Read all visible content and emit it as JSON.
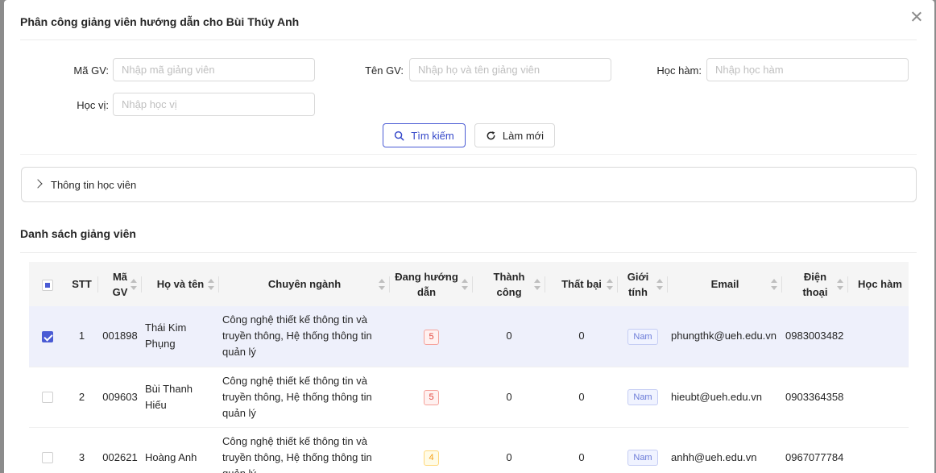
{
  "modal": {
    "title": "Phân công giảng viên hướng dẫn cho Bùi Thúy Anh"
  },
  "filters": {
    "ma_gv": {
      "label": "Mã GV:",
      "placeholder": "Nhập mã giảng viên"
    },
    "ten_gv": {
      "label": "Tên GV:",
      "placeholder": "Nhập họ và tên giảng viên"
    },
    "hoc_ham": {
      "label": "Học hàm:",
      "placeholder": "Nhập học hàm"
    },
    "hoc_vi": {
      "label": "Học vị:",
      "placeholder": "Nhập học vị"
    },
    "search_label": "Tìm kiếm",
    "reset_label": "Làm mới"
  },
  "collapse": {
    "label": "Thông tin học viên"
  },
  "section": {
    "title": "Danh sách giảng viên"
  },
  "table": {
    "headers": [
      "STT",
      "Mã GV",
      "Họ và tên",
      "Chuyên ngành",
      "Đang hướng dẫn",
      "Thành công",
      "Thất bại",
      "Giới tính",
      "Email",
      "Điện thoại",
      "Học hàm"
    ],
    "rows": [
      {
        "checked": true,
        "stt": "1",
        "ma_gv": "001898",
        "ho_ten": "Thái Kim Phụng",
        "chuyen_nganh": "Công nghệ thiết kế thông tin và truyền thông, Hệ thống thông tin quản lý",
        "dang_huong_dan": "5",
        "thanh_cong": "0",
        "that_bai": "0",
        "gioi_tinh": "Nam",
        "email": "phungthk@ueh.edu.vn",
        "dien_thoai": "0983003482"
      },
      {
        "checked": false,
        "stt": "2",
        "ma_gv": "009603",
        "ho_ten": "Bùi Thanh Hiếu",
        "chuyen_nganh": "Công nghệ thiết kế thông tin và truyền thông, Hệ thống thông tin quản lý",
        "dang_huong_dan": "5",
        "thanh_cong": "0",
        "that_bai": "0",
        "gioi_tinh": "Nam",
        "email": "hieubt@ueh.edu.vn",
        "dien_thoai": "0903364358"
      },
      {
        "checked": false,
        "stt": "3",
        "ma_gv": "002621",
        "ho_ten": "Hoàng Anh",
        "chuyen_nganh": "Công nghệ thiết kế thông tin và truyền thông, Hệ thống thông tin quản lý",
        "dang_huong_dan": "4",
        "thanh_cong": "0",
        "that_bai": "0",
        "gioi_tinh": "Nam",
        "email": "anhh@ueh.edu.vn",
        "dien_thoai": "0967077784"
      }
    ]
  },
  "colors": {
    "primary": "#4a5bd4",
    "selected_row": "#eef0fb",
    "badge_red": "#e0453b",
    "badge_orange": "#f4a21c"
  }
}
